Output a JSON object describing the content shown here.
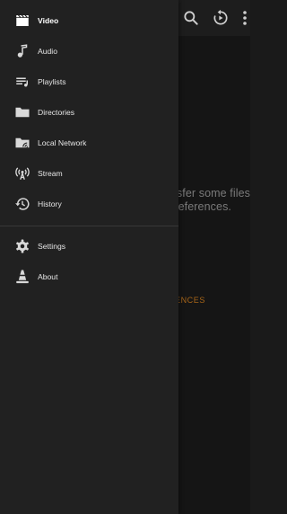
{
  "background_screen": {
    "empty_text_line1": "sfer some files",
    "empty_text_line2": "references.",
    "preferences_link": "ENCES"
  },
  "toolbar": {
    "icons": [
      "search-icon",
      "resume-playback-icon",
      "overflow-menu-icon"
    ]
  },
  "drawer": {
    "primary_items": [
      {
        "label": "Video",
        "icon": "video-clapper-icon",
        "active": true
      },
      {
        "label": "Audio",
        "icon": "music-note-icon"
      },
      {
        "label": "Playlists",
        "icon": "playlist-icon"
      },
      {
        "label": "Directories",
        "icon": "folder-icon"
      },
      {
        "label": "Local Network",
        "icon": "network-folder-icon"
      },
      {
        "label": "Stream",
        "icon": "stream-antenna-icon"
      },
      {
        "label": "History",
        "icon": "history-icon"
      }
    ],
    "secondary_items": [
      {
        "label": "Settings",
        "icon": "gear-icon"
      },
      {
        "label": "About",
        "icon": "vlc-cone-icon"
      }
    ]
  },
  "colors": {
    "drawer_bg": "#212121",
    "app_bg": "#151515",
    "accent": "#a76518",
    "text": "#e6e6e6"
  }
}
